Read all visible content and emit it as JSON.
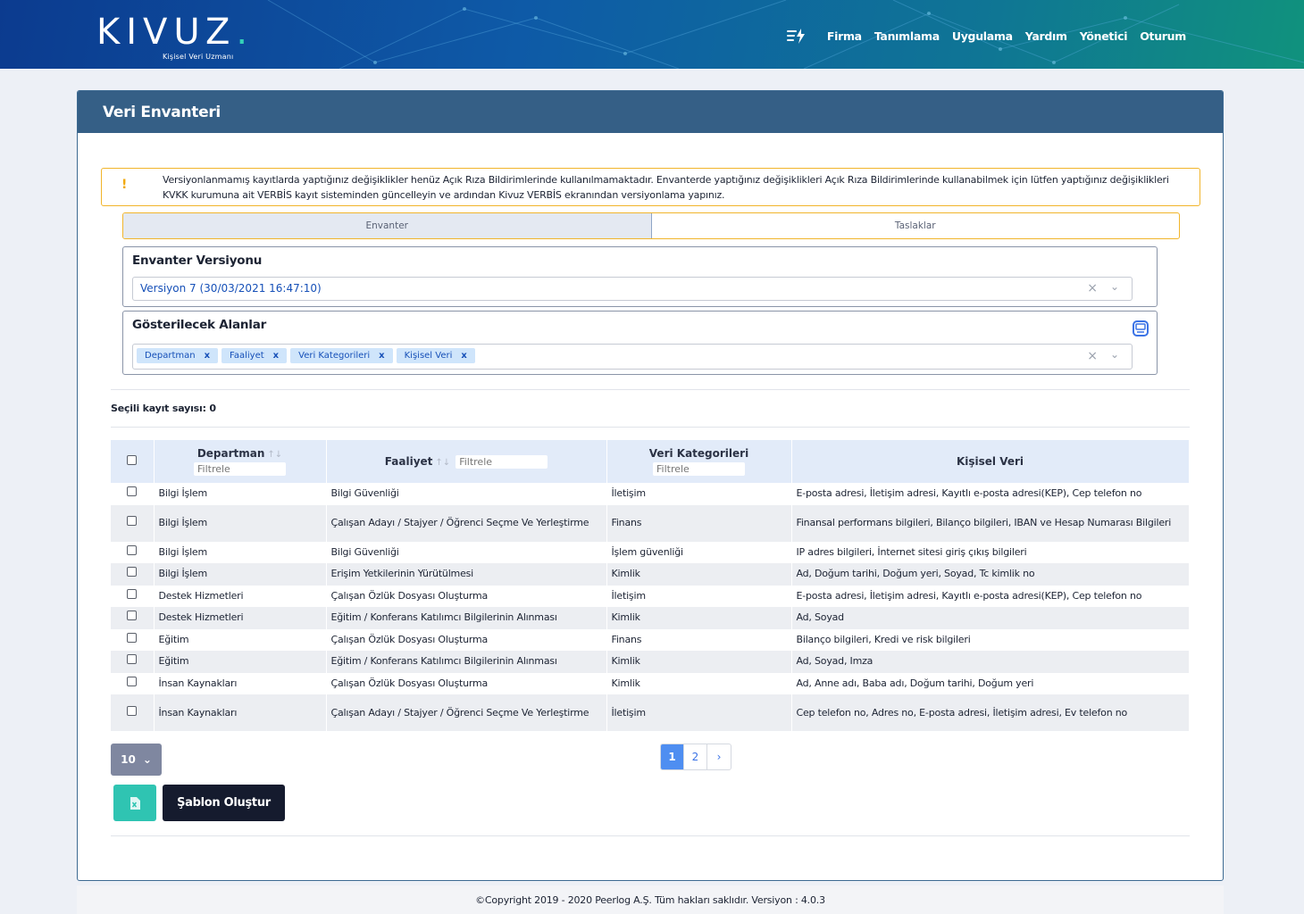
{
  "brand": {
    "logo_text": "KIVUZ",
    "logo_dot": ".",
    "logo_sub": "Kişisel Veri Uzmanı"
  },
  "nav": {
    "items": [
      "Firma",
      "Tanımlama",
      "Uygulama",
      "Yardım",
      "Yönetici",
      "Oturum"
    ]
  },
  "card": {
    "title": "Veri Envanteri"
  },
  "alert": {
    "icon": "!",
    "text": "Versiyonlanmamış kayıtlarda yaptığınız değişiklikler henüz Açık Rıza Bildirimlerinde kullanılmamaktadır. Envanterde yaptığınız değişiklikleri Açık Rıza Bildirimlerinde kullanabilmek için lütfen yaptığınız değişiklikleri KVKK kurumuna ait VERBİS kayıt sisteminden güncelleyin ve ardından Kivuz VERBİS ekranından versiyonlama yapınız."
  },
  "tabs": [
    {
      "label": "Envanter",
      "active": true
    },
    {
      "label": "Taslaklar",
      "active": false
    }
  ],
  "version_panel": {
    "title": "Envanter Versiyonu",
    "selected": "Versiyon 7 (30/03/2021 16:47:10)"
  },
  "fields_panel": {
    "title": "Gösterilecek Alanlar",
    "chips": [
      "Departman",
      "Faaliyet",
      "Veri Kategorileri",
      "Kişisel Veri"
    ],
    "chip_remove": "x"
  },
  "select_glyphs": {
    "clear": "×",
    "open": "⌄"
  },
  "selected_count": "Seçili kayıt sayısı: 0",
  "table": {
    "columns": [
      "Departman",
      "Faaliyet",
      "Veri Kategorileri",
      "Kişisel Veri"
    ],
    "filter_placeholder": "Filtrele",
    "sort_glyph": "↑↓",
    "rows": [
      [
        "Bilgi İşlem",
        "Bilgi Güvenliği",
        "İletişim",
        "E-posta adresi, İletişim adresi, Kayıtlı e-posta adresi(KEP), Cep telefon no"
      ],
      [
        "Bilgi İşlem",
        "Çalışan Adayı / Stajyer / Öğrenci Seçme Ve Yerleştirme",
        "Finans",
        "Finansal performans bilgileri, Bilanço bilgileri, IBAN ve Hesap Numarası Bilgileri"
      ],
      [
        "Bilgi İşlem",
        "Bilgi Güvenliği",
        "İşlem güvenliği",
        "IP adres bilgileri, İnternet sitesi giriş çıkış bilgileri"
      ],
      [
        "Bilgi İşlem",
        "Erişim Yetkilerinin Yürütülmesi",
        "Kimlik",
        "Ad, Doğum tarihi, Doğum yeri, Soyad, Tc kimlik no"
      ],
      [
        "Destek Hizmetleri",
        "Çalışan Özlük Dosyası Oluşturma",
        "İletişim",
        "E-posta adresi, İletişim adresi, Kayıtlı e-posta adresi(KEP), Cep telefon no"
      ],
      [
        "Destek Hizmetleri",
        "Eğitim / Konferans Katılımcı Bilgilerinin Alınması",
        "Kimlik",
        "Ad, Soyad"
      ],
      [
        "Eğitim",
        "Çalışan Özlük Dosyası Oluşturma",
        "Finans",
        "Bilanço bilgileri, Kredi ve risk bilgileri"
      ],
      [
        "Eğitim",
        "Eğitim / Konferans Katılımcı Bilgilerinin Alınması",
        "Kimlik",
        "Ad, Soyad, Imza"
      ],
      [
        "İnsan Kaynakları",
        "Çalışan Özlük Dosyası Oluşturma",
        "Kimlik",
        "Ad, Anne adı, Baba adı, Doğum tarihi, Doğum yeri"
      ],
      [
        "İnsan Kaynakları",
        "Çalışan Adayı / Stajyer / Öğrenci Seçme Ve Yerleştirme",
        "İletişim",
        "Cep telefon no, Adres no, E-posta adresi, İletişim adresi, Ev telefon no"
      ]
    ]
  },
  "pagination": {
    "pages": [
      "1",
      "2"
    ],
    "current": "1",
    "next": "›"
  },
  "page_size": {
    "value": "10",
    "caret": "⌄"
  },
  "buttons": {
    "template": "Şablon Oluştur"
  },
  "footer": {
    "text": "©Copyright 2019 - 2020 Peerlog A.Ş. Tüm hakları saklıdır. Versiyon : 4.0.3"
  },
  "colors": {
    "header_bar": "#355f86",
    "alert_border": "#f1b52b",
    "excel_button": "#2fc4b2",
    "template_button": "#151b2e",
    "chip_bg": "#cfe5fb",
    "page_active": "#4e8ef1"
  }
}
